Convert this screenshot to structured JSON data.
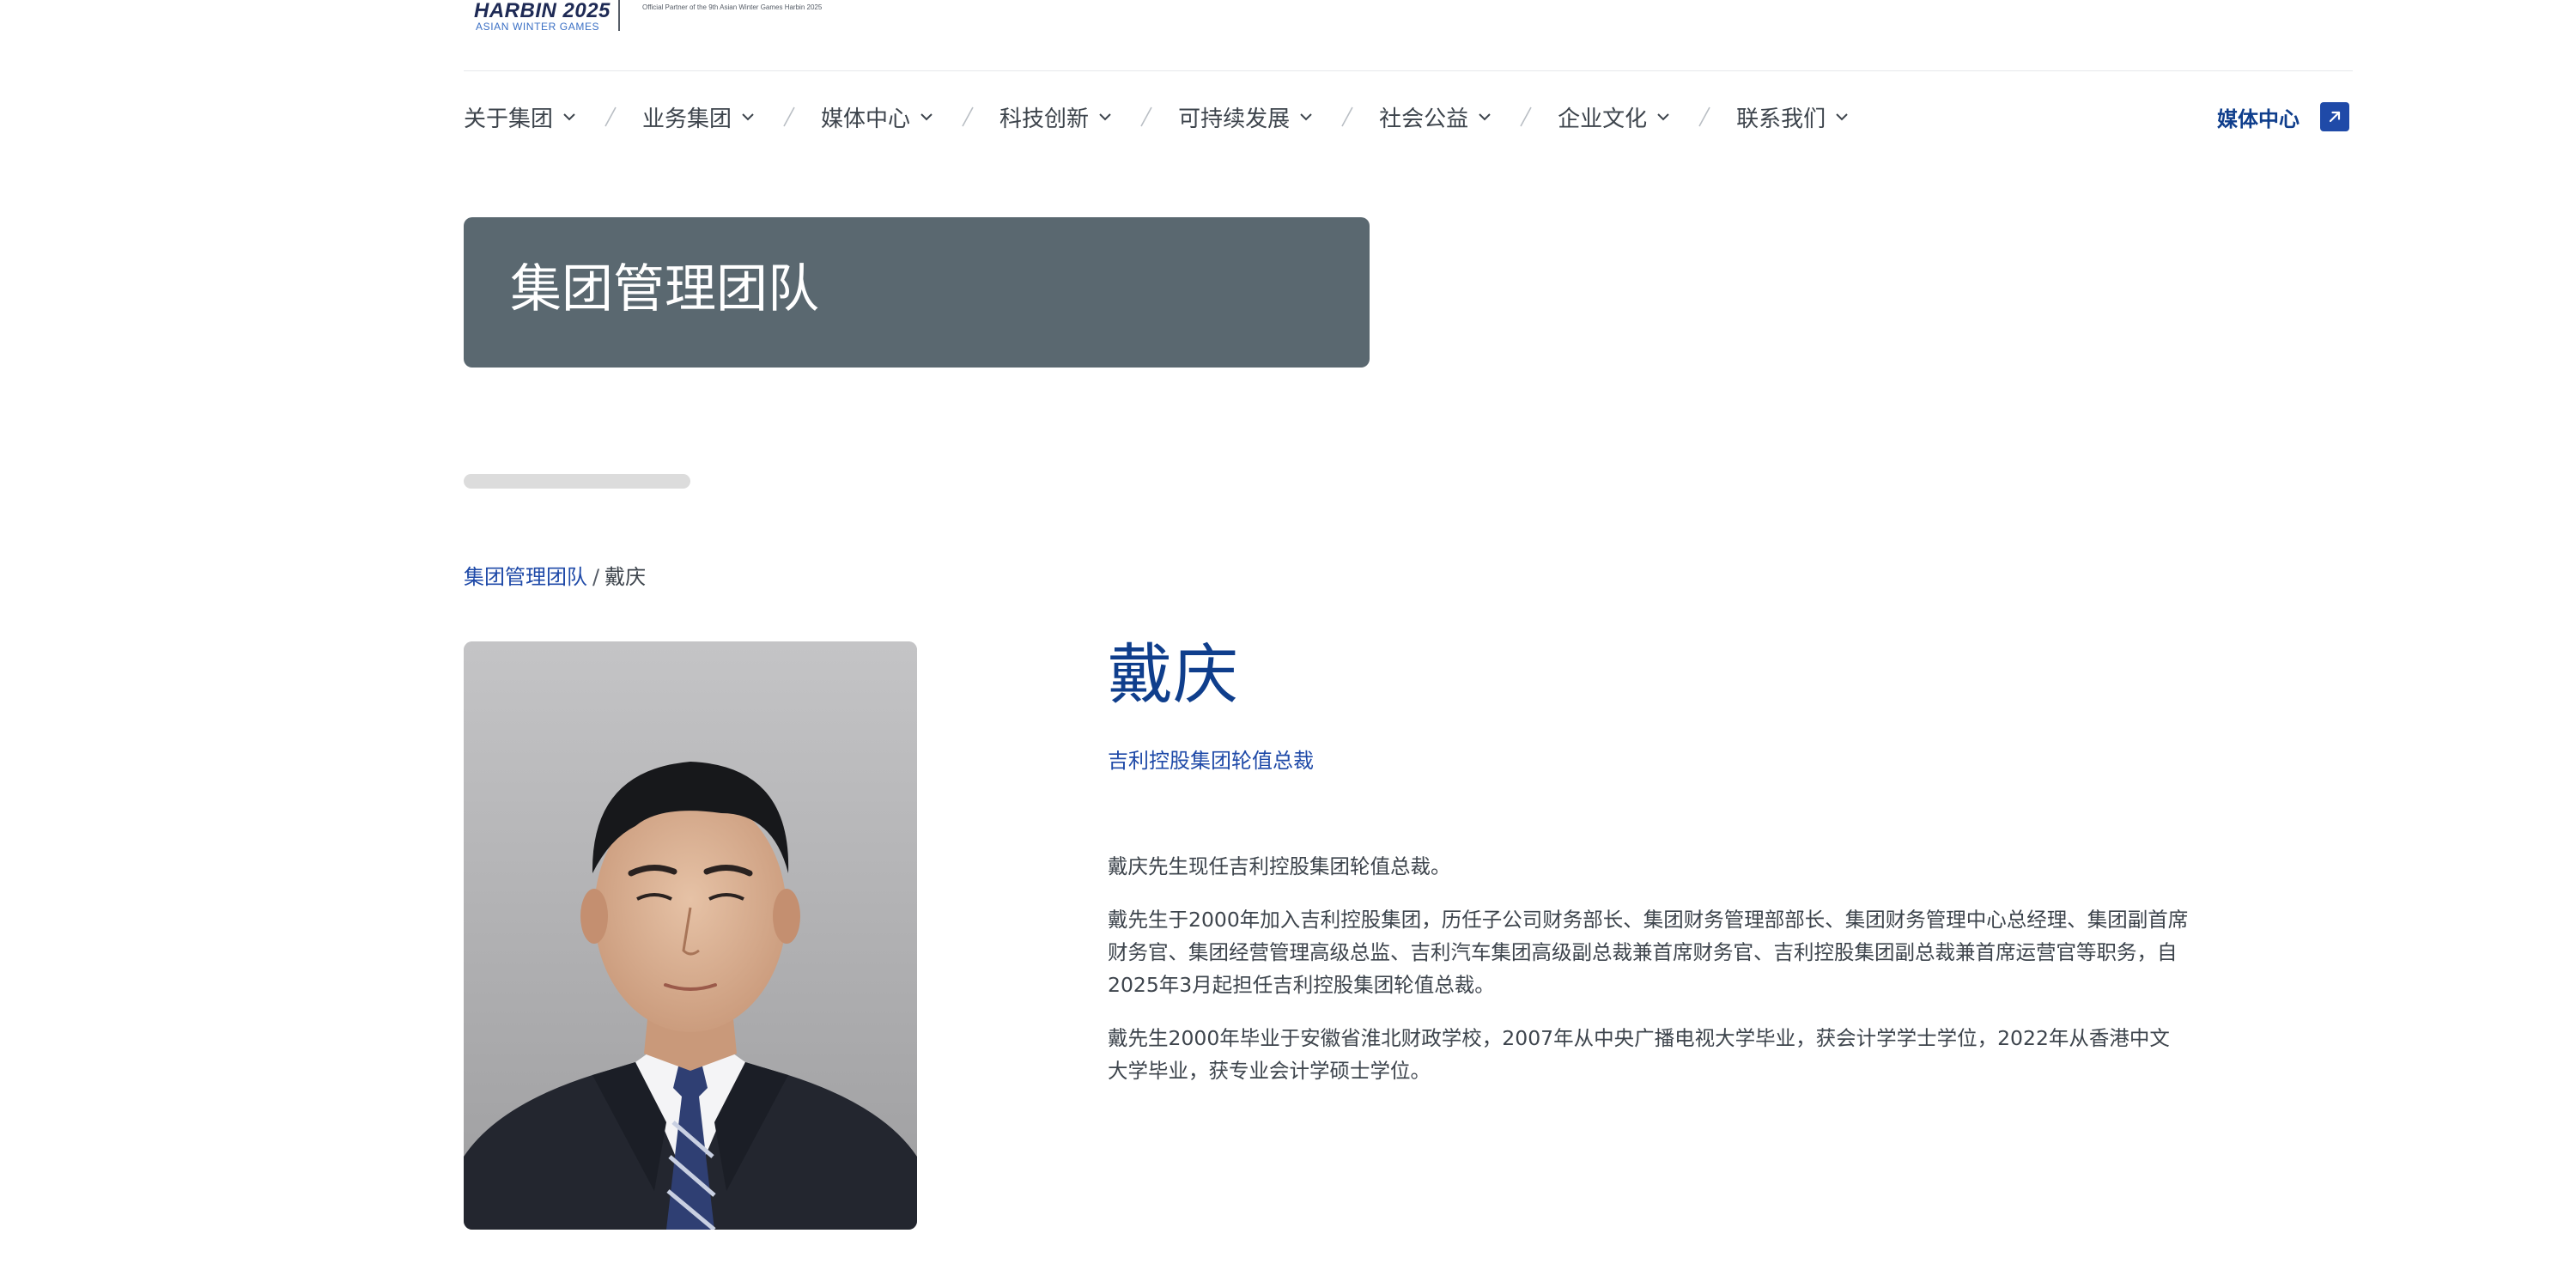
{
  "logo": {
    "event_title": "HARBIN 2025",
    "event_subtitle": "ASIAN WINTER GAMES",
    "partner_text": "Official Partner of the 9th Asian Winter Games Harbin 2025"
  },
  "nav": {
    "items": [
      {
        "label": "关于集团"
      },
      {
        "label": "业务集团"
      },
      {
        "label": "媒体中心"
      },
      {
        "label": "科技创新"
      },
      {
        "label": "可持续发展"
      },
      {
        "label": "社会公益"
      },
      {
        "label": "企业文化"
      },
      {
        "label": "联系我们"
      }
    ],
    "right_link": "媒体中心"
  },
  "banner": {
    "title": "集团管理团队"
  },
  "breadcrumb": {
    "parent": "集团管理团队",
    "separator": "/",
    "current": "戴庆"
  },
  "profile": {
    "name": "戴庆",
    "position": "吉利控股集团轮值总裁",
    "bio": [
      "戴庆先生现任吉利控股集团轮值总裁。",
      "戴先生于2000年加入吉利控股集团，历任子公司财务部长、集团财务管理部部长、集团财务管理中心总经理、集团副首席财务官、集团经营管理高级总监、吉利汽车集团高级副总裁兼首席财务官、吉利控股集团副总裁兼首席运营官等职务，自2025年3月起担任吉利控股集团轮值总裁。",
      "戴先生2000年毕业于安徽省淮北财政学校，2007年从中央广播电视大学毕业，获会计学学士学位，2022年从香港中文大学毕业，获专业会计学硕士学位。"
    ]
  },
  "colors": {
    "brand_blue": "#0f3e8c",
    "link_blue": "#1f4aa8",
    "banner_bg": "#5a6870"
  },
  "icons": {
    "nav_dropdown": "chevron-down-icon",
    "nav_separator": "slash-separator",
    "external_link": "external-link-icon"
  }
}
